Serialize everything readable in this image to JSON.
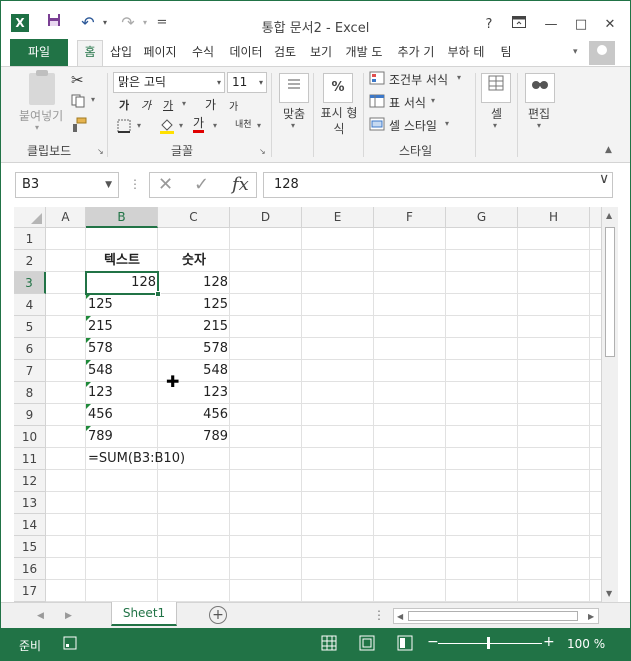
{
  "titlebar": {
    "title": "통합 문서2 - Excel",
    "help": "?",
    "restore_icon": "□",
    "minimize": "—",
    "maximize": "□",
    "close": "✕",
    "excel_logo": "X",
    "undo": "↶",
    "redo": "↷",
    "qat_more": "="
  },
  "tabs": {
    "file": "파일",
    "items": [
      "홈",
      "삽입",
      "페이지",
      "수식",
      "데이터",
      "검토",
      "보기",
      "개발 도",
      "추가 기",
      "부하 테",
      "팀"
    ],
    "more": "▾"
  },
  "ribbon": {
    "clipboard": {
      "paste": "붙여넣기",
      "label": "클립보드"
    },
    "font": {
      "name": "맑은 고딕",
      "size": "11",
      "bold": "가",
      "italic": "가",
      "underline": "가",
      "grow": "가",
      "shrink": "가",
      "font_color": "가",
      "phonetic": "내천",
      "label": "글꼴"
    },
    "align": {
      "label": "맞춤"
    },
    "number": {
      "label": "표시 형식",
      "icon": "%"
    },
    "styles": {
      "conditional": "조건부 서식",
      "table": "표 서식",
      "cell_style": "셀 스타일",
      "label": "스타일"
    },
    "cells": {
      "label": "셀"
    },
    "editing": {
      "label": "편집"
    }
  },
  "formula_bar": {
    "name_box": "B3",
    "cancel": "✕",
    "enter": "✓",
    "fx": "fx",
    "content": "128",
    "expand": "∨"
  },
  "grid": {
    "columns": [
      "A",
      "B",
      "C",
      "D",
      "E",
      "F",
      "G",
      "H"
    ],
    "rows": [
      "1",
      "2",
      "3",
      "4",
      "5",
      "6",
      "7",
      "8",
      "9",
      "10",
      "11",
      "12",
      "13",
      "14",
      "15",
      "16",
      "17"
    ],
    "selected_column": "B",
    "selected_row": "3",
    "header_text": "텍스트",
    "header_number": "숫자",
    "b_values": [
      "128",
      "125",
      "215",
      "578",
      "548",
      "123",
      "456",
      "789"
    ],
    "c_values": [
      "128",
      "125",
      "215",
      "578",
      "548",
      "123",
      "456",
      "789"
    ],
    "formula_text": "=SUM(B3:B10)"
  },
  "sheetbar": {
    "prev": "◀",
    "next": "▶",
    "sheet": "Sheet1",
    "add": "+",
    "options": "⋮"
  },
  "statusbar": {
    "ready": "준비",
    "zoom_minus": "−",
    "zoom_plus": "+",
    "zoom": "100 %"
  }
}
